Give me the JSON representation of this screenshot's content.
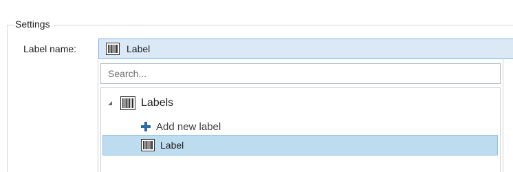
{
  "settings": {
    "group_title": "Settings",
    "label_name_label": "Label name:",
    "selected_value": "Label"
  },
  "dropdown": {
    "search_placeholder": "Search...",
    "search_value": "",
    "tree": {
      "root": {
        "label": "Labels",
        "icon": "barcode-icon",
        "expanded": true
      },
      "children": [
        {
          "label": "Add new label",
          "icon": "plus-icon"
        },
        {
          "label": "Label",
          "icon": "barcode-icon",
          "selected": true
        }
      ]
    }
  },
  "colors": {
    "selection_fill": "#bedcef",
    "selection_border": "#8bc1e4",
    "combo_fill": "#dbe9f7",
    "combo_border": "#7eb4ea",
    "plus_icon": "#2d6ca2"
  }
}
